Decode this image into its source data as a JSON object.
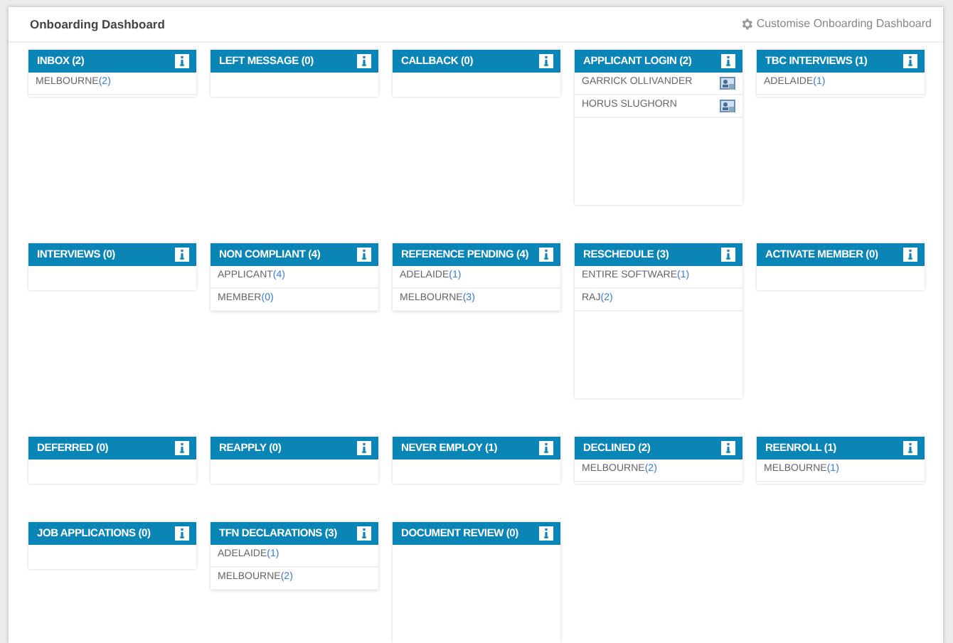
{
  "title": "Onboarding Dashboard",
  "customise_link": "Customise Onboarding Dashboard",
  "cards": [
    {
      "title": "INBOX (2)",
      "kind": "short",
      "items": [
        {
          "kind": "count",
          "label": "MELBOURNE",
          "count": "(2)"
        }
      ]
    },
    {
      "title": "LEFT MESSAGE (0)",
      "kind": "short"
    },
    {
      "title": "CALLBACK (0)",
      "kind": "short"
    },
    {
      "title": "APPLICANT LOGIN (2)",
      "kind": "tall",
      "items": [
        {
          "kind": "person",
          "label": "GARRICK OLLIVANDER"
        },
        {
          "kind": "person",
          "label": "HORUS SLUGHORN"
        }
      ]
    },
    {
      "title": "TBC INTERVIEWS (1)",
      "kind": "short",
      "items": [
        {
          "kind": "count",
          "label": "ADELAIDE",
          "count": "(1)"
        }
      ]
    },
    {
      "title": "INTERVIEWS (0)",
      "kind": "short"
    },
    {
      "title": "NON COMPLIANT (4)",
      "kind": "short",
      "items": [
        {
          "kind": "count",
          "label": "APPLICANT",
          "count": "(4)"
        },
        {
          "kind": "count",
          "label": "MEMBER",
          "count": "(0)"
        }
      ]
    },
    {
      "title": "REFERENCE PENDING (4)",
      "kind": "short",
      "items": [
        {
          "kind": "count",
          "label": "ADELAIDE",
          "count": "(1)"
        },
        {
          "kind": "count",
          "label": "MELBOURNE",
          "count": "(3)"
        }
      ]
    },
    {
      "title": "RESCHEDULE (3)",
      "kind": "tall",
      "items": [
        {
          "kind": "count",
          "label": "ENTIRE SOFTWARE",
          "count": "(1)"
        },
        {
          "kind": "count",
          "label": "RAJ",
          "count": "(2)"
        }
      ]
    },
    {
      "title": "ACTIVATE MEMBER (0)",
      "kind": "short"
    },
    {
      "title": "DEFERRED (0)",
      "kind": "short"
    },
    {
      "title": "REAPPLY (0)",
      "kind": "short"
    },
    {
      "title": "NEVER EMPLOY (1)",
      "kind": "short"
    },
    {
      "title": "DECLINED (2)",
      "kind": "short",
      "items": [
        {
          "kind": "count",
          "label": "MELBOURNE",
          "count": "(2)"
        }
      ]
    },
    {
      "title": "REENROLL (1)",
      "kind": "short",
      "items": [
        {
          "kind": "count",
          "label": "MELBOURNE",
          "count": "(1)"
        }
      ]
    },
    {
      "title": "JOB APPLICATIONS (0)",
      "kind": "short"
    },
    {
      "title": "TFN DECLARATIONS (3)",
      "kind": "short",
      "items": [
        {
          "kind": "count",
          "label": "ADELAIDE",
          "count": "(1)"
        },
        {
          "kind": "count",
          "label": "MELBOURNE",
          "count": "(2)"
        }
      ]
    },
    {
      "title": "DOCUMENT REVIEW (0)",
      "kind": "tall"
    }
  ]
}
